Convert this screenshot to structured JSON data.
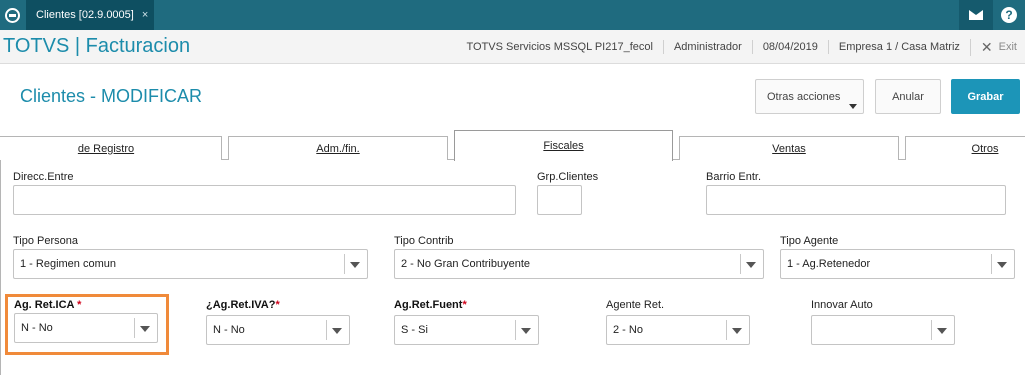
{
  "topbar": {
    "tab_label": "Clientes [02.9.0005]",
    "tab_close": "×",
    "help_glyph": "?"
  },
  "header": {
    "app_title": "TOTVS | Facturacion",
    "environment": "TOTVS Servicios MSSQL PI217_fecol",
    "user": "Administrador",
    "date": "08/04/2019",
    "company": "Empresa 1 / Casa Matriz",
    "exit_label": "Exit"
  },
  "page": {
    "title": "Clientes - MODIFICAR",
    "buttons": {
      "otras_acciones": "Otras acciones",
      "anular": "Anular",
      "grabar": "Grabar"
    }
  },
  "tabs": [
    {
      "label": "de Registro"
    },
    {
      "label": "Adm./fin."
    },
    {
      "label": "Fiscales"
    },
    {
      "label": "Ventas"
    },
    {
      "label": "Otros"
    }
  ],
  "form": {
    "direcc_entre": {
      "label": "Direcc.Entre",
      "value": ""
    },
    "grp_clientes": {
      "label": "Grp.Clientes",
      "value": ""
    },
    "barrio_entr": {
      "label": "Barrio Entr.",
      "value": ""
    },
    "tipo_persona": {
      "label": "Tipo Persona",
      "value": "1 - Regimen comun"
    },
    "tipo_contrib": {
      "label": "Tipo Contrib",
      "value": "2 - No Gran Contribuyente"
    },
    "tipo_agente": {
      "label": "Tipo Agente",
      "value": "1 - Ag.Retenedor"
    },
    "ag_ret_ica": {
      "label": "Ag. Ret.ICA",
      "required": "*",
      "value": "N - No"
    },
    "ag_ret_iva": {
      "label": "¿Ag.Ret.IVA?",
      "required": "*",
      "value": "N - No"
    },
    "ag_ret_fuent": {
      "label": "Ag.Ret.Fuent",
      "required": "*",
      "value": "S - Si"
    },
    "agente_ret": {
      "label": "Agente Ret.",
      "value": "2 - No"
    },
    "innovar_auto": {
      "label": "Innovar Auto",
      "value": ""
    }
  },
  "colors": {
    "topbar": "#1f6b7f",
    "accent": "#1c8cab",
    "primary_button": "#1c95b8",
    "highlight_box": "#f08a3a",
    "required_mark": "#d0021b"
  }
}
